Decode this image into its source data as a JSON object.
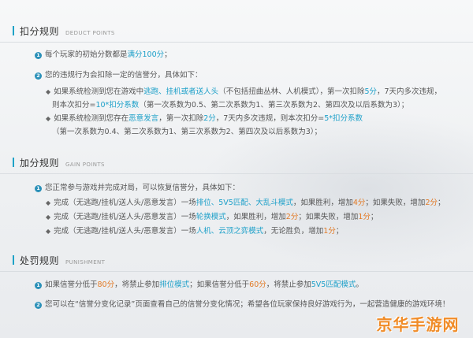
{
  "deduct": {
    "title": "扣分规则",
    "subtitle": "DEDUCT POINTS",
    "item1": {
      "num": "1",
      "a": "每个玩家的初始分数都是",
      "b": "满分100分",
      "c": "；"
    },
    "item2": {
      "num": "2",
      "text": "您的违规行为会扣除一定的信誉分，具体如下："
    },
    "sub1": {
      "a": "如果系统检测到您在游戏中",
      "b": "逃跑、挂机或者送人头",
      "c": "（不包括扭曲丛林、人机模式），第一次扣除",
      "d": "5分",
      "e": "，7天内多次违规，",
      "f": "则本次扣分=",
      "g": "10*扣分系数",
      "h": "（第一次系数为0.5、第二次系数为1、第三次系数为2、第四次及以后系数为3）；"
    },
    "sub2": {
      "a": "如果系统检测到您存在",
      "b": "恶意发言",
      "c": "，第一次扣除",
      "d": "2分",
      "e": "，7天内多次违规，则本次扣分=",
      "f": "5*扣分系数",
      "g": "（第一次系数为0.4、第二次系数为1、第三次系数为2、第四次及以后系数为3）；"
    }
  },
  "gain": {
    "title": "加分规则",
    "subtitle": "GAIN POINTS",
    "item1": {
      "num": "1",
      "text": "您正常参与游戏并完成对局，可以恢复信誉分，具体如下："
    },
    "sub1": {
      "a": "完成（无逃跑/挂机/送人头/恶意发言）一场",
      "b": "排位、5V5匹配、大乱斗模式",
      "c": "，如果胜利，增加",
      "d": "4分",
      "e": "；如果失败，增加",
      "f": "2分",
      "g": "；"
    },
    "sub2": {
      "a": "完成（无逃跑/挂机/送人头/恶意发言）一场",
      "b": "轮换模式",
      "c": "，如果胜利，增加",
      "d": "2分",
      "e": "；如果失败，增加",
      "f": "1分",
      "g": "；"
    },
    "sub3": {
      "a": "完成（无逃跑/挂机/送人头/恶意发言）一场",
      "b": "人机、云顶之弈模式",
      "c": "，无论胜负，增加",
      "d": "1分",
      "e": "；"
    }
  },
  "punish": {
    "title": "处罚规则",
    "subtitle": "PUNISHMENT",
    "item1": {
      "num": "1",
      "a": "如果信誉分低于",
      "b": "80分",
      "c": "，将禁止参加",
      "d": "排位模式",
      "e": "；如果信誉分低于",
      "f": "60分",
      "g": "，将禁止参加",
      "h": "5V5匹配模式",
      "i": "。"
    },
    "item2": {
      "num": "2",
      "text": "您可以在“信誉分变化记录”页面查看自己的信誉分变化情况；希望各位玩家保持良好游戏行为，一起营造健康的游戏环境！"
    }
  },
  "watermark": "京华手游网",
  "colors": {
    "accent": "#1da0c9",
    "orange": "#e27a25",
    "badge": "#2a90b8"
  }
}
